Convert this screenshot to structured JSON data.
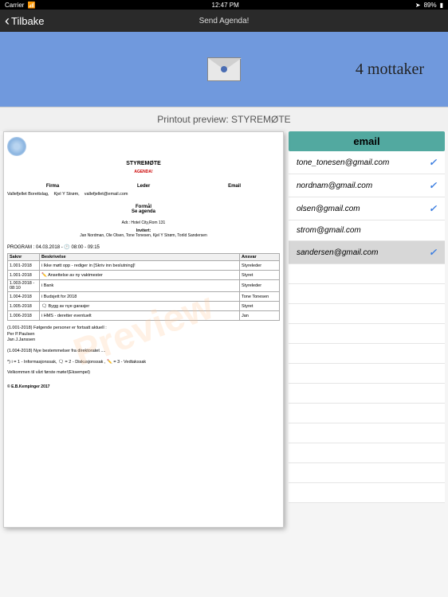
{
  "status": {
    "carrier": "Carrier",
    "time": "12:47 PM",
    "battery": "89%"
  },
  "nav": {
    "back": "Tilbake",
    "title": "Send Agenda!"
  },
  "banner": {
    "recipients": "4 mottaker"
  },
  "preview_label": "Printout preview: STYREMØTE",
  "doc": {
    "title": "STYREMØTE",
    "agenda_label": "AGENDA!",
    "firm_hdr": {
      "a": "Firma",
      "b": "Leder",
      "c": "Email"
    },
    "firm_val": {
      "a": "Vallefjellet Borettslag,",
      "b": "Kjel Y Strøm,",
      "c": "vallefjellet@email.com"
    },
    "formal_hdr": "Formål",
    "formal_val": "Se agenda",
    "adr": "Adr.: Hotel City,Rom 131",
    "inv_hdr": "Invitert:",
    "invited": "Jan Nordman, Ole Olsen, Tone Tonesen, Kjel Y Strøm, Torild Sandersen",
    "program": "PROGRAM : 04.03.2018 -  🕐 08:00 - 09:15",
    "thead": {
      "sak": "Saknr",
      "besk": "Beskrivelse",
      "ansvar": "Ansvar"
    },
    "rows": [
      {
        "s": "1.001-2018",
        "b": "i Ikke møtt opp - rediger in [Skriv inn beslutning]!",
        "a": "Styreleder"
      },
      {
        "s": "1.001-2018",
        "b": "✏️ Ansettelse av ny vaktmester",
        "a": "Styret"
      },
      {
        "s": "1.003-2018 - 08:10",
        "b": "i Bank",
        "a": "Styreleder"
      },
      {
        "s": "1.004-2018",
        "b": "i Budsjett for 2018",
        "a": "Tone Tonesen"
      },
      {
        "s": "1.005-2018",
        "b": "🗨 Bygg av nye garasjer",
        "a": "Styret"
      },
      {
        "s": "1.006-2018",
        "b": "i HMS - deretter eventuelt",
        "a": "Jan"
      }
    ],
    "notes": {
      "n1": "(1.001-2018)           Følgende personer er fortsatt aktuell :",
      "n2": "Per P.Paulsen",
      "n3": "Jan J.Janssen",
      "n4": "(1.004-2018)           Nye bestemmelser fra direktoratet ....",
      "n5": "*) i = 1 - Informasjonssak, 🗨 = 2 - Diskusjonssak , ✏️ = 3 - Vedtakssak",
      "n6": "Velkommen til vårt første møte!(Eksempel)"
    },
    "copyright": "© E.B.Kempinger 2017"
  },
  "email": {
    "header": "email",
    "items": [
      {
        "addr": "tone_tonesen@gmail.com",
        "checked": true,
        "selected": false
      },
      {
        "addr": "nordnam@gmail.com",
        "checked": true,
        "selected": false
      },
      {
        "addr": "olsen@gmail.com",
        "checked": true,
        "selected": false
      },
      {
        "addr": "strom@gmail.com",
        "checked": false,
        "selected": false
      },
      {
        "addr": "sandersen@gmail.com",
        "checked": true,
        "selected": true
      }
    ]
  }
}
